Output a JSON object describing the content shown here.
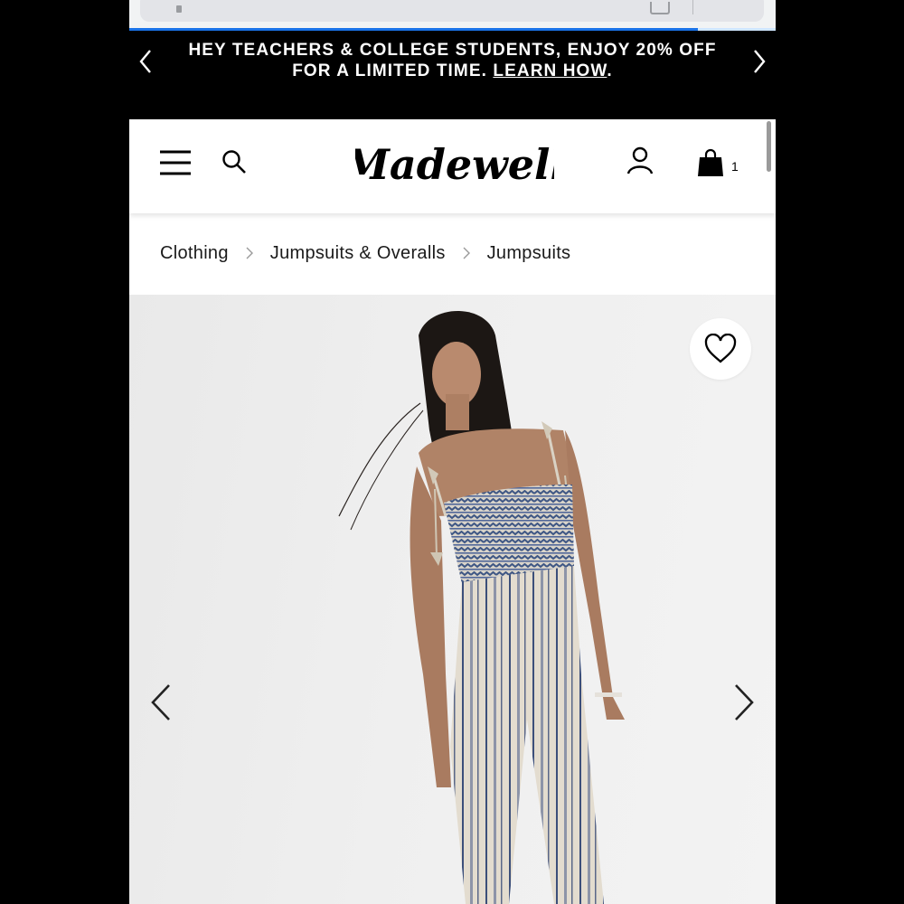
{
  "promo": {
    "line1": "HEY TEACHERS & COLLEGE STUDENTS, ENJOY 20% OFF",
    "line2_prefix": "FOR A LIMITED TIME. ",
    "link": "LEARN HOW",
    "line2_suffix": "."
  },
  "header": {
    "logo_text": "Madewell",
    "bag_count": "1"
  },
  "breadcrumb": [
    "Clothing",
    "Jumpsuits & Overalls",
    "Jumpsuits"
  ],
  "icons": {
    "promo_prev": "chevron-left-icon",
    "promo_next": "chevron-right-icon",
    "menu": "hamburger-menu-icon",
    "search": "search-icon",
    "account": "user-icon",
    "bag": "shopping-bag-icon",
    "wishlist": "heart-icon",
    "image_prev": "chevron-left-icon",
    "image_next": "chevron-right-icon"
  },
  "colors": {
    "banner_bg": "#000000",
    "banner_text": "#ffffff",
    "progress": "#1a73e8"
  },
  "load_progress": 0.88
}
